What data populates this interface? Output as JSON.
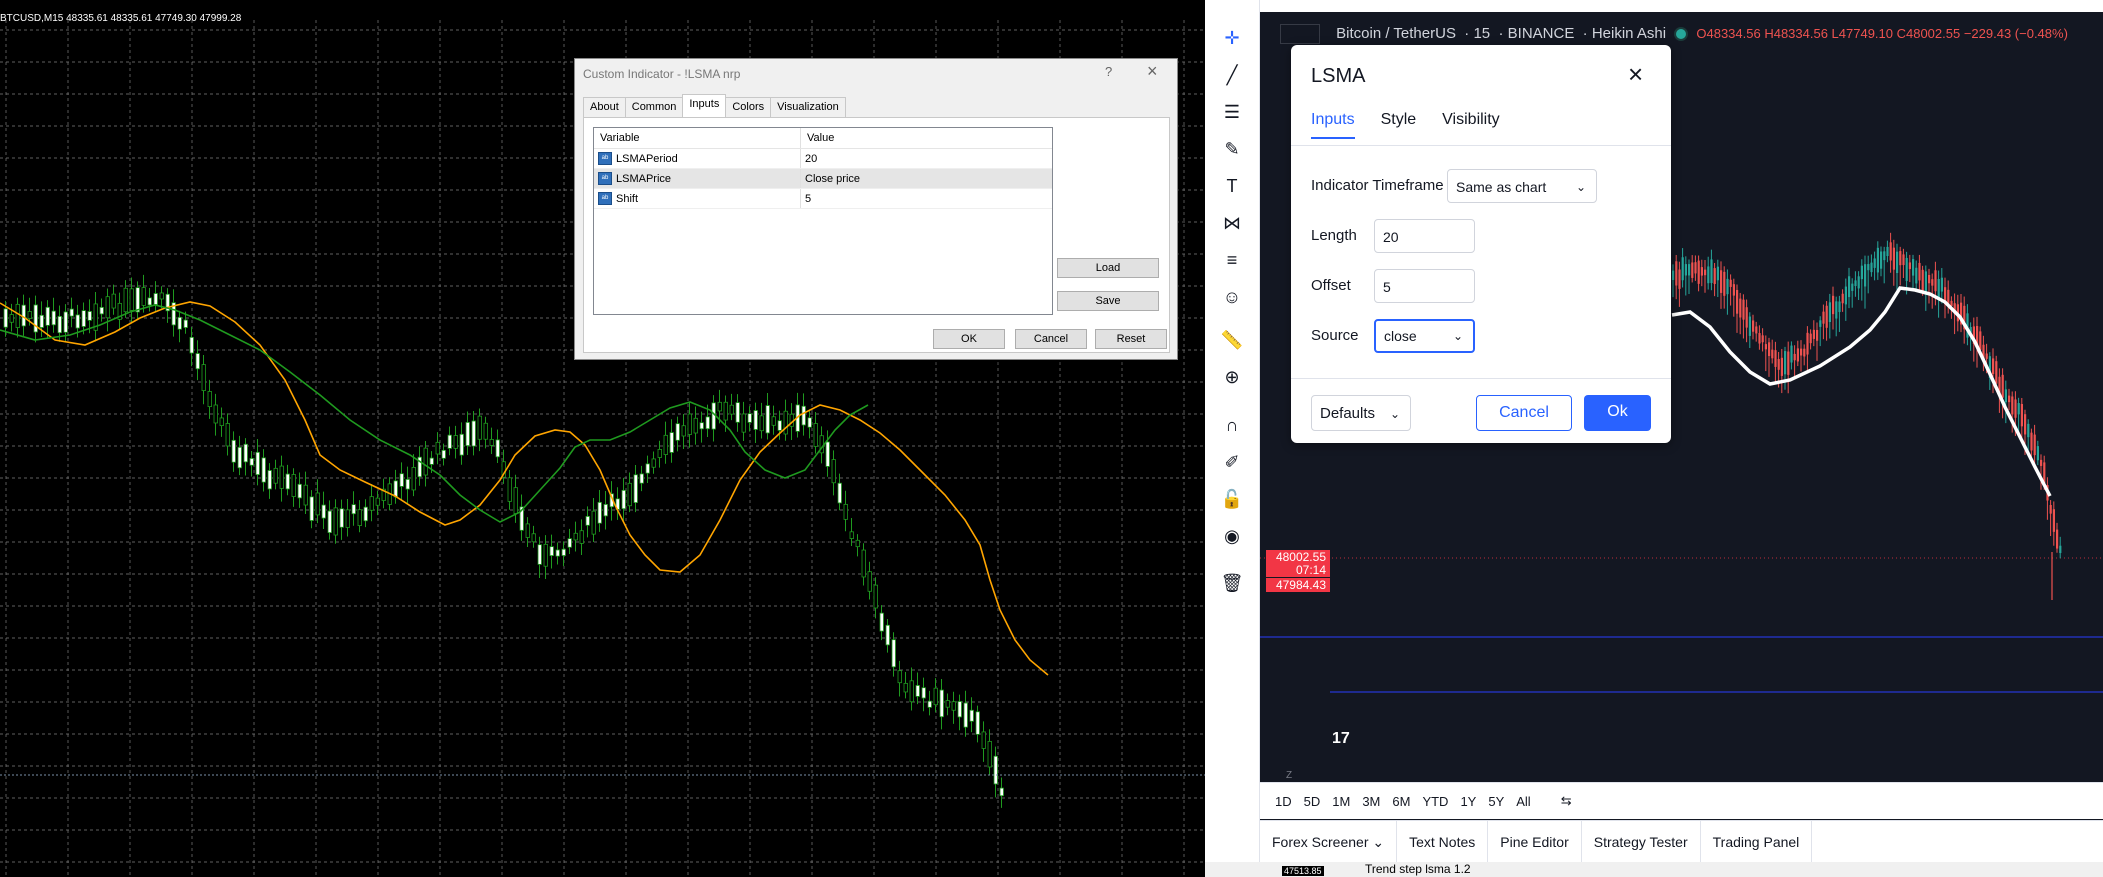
{
  "mt4": {
    "chart_info": "BTCUSD,M15  48335.61 48335.61 47749.30 47999.28",
    "bottom_price": "47513.85",
    "dialog": {
      "title": "Custom Indicator - !LSMA nrp",
      "help": "?",
      "close": "×",
      "tabs": [
        "About",
        "Common",
        "Inputs",
        "Colors",
        "Visualization"
      ],
      "active_tab": "Inputs",
      "table_headers": {
        "variable": "Variable",
        "value": "Value"
      },
      "params": [
        {
          "icon": "ab",
          "name": "LSMAPeriod",
          "value": "20"
        },
        {
          "icon": "ab",
          "name": "LSMAPrice",
          "value": "Close price"
        },
        {
          "icon": "ab",
          "name": "Shift",
          "value": "5"
        }
      ],
      "buttons": {
        "load": "Load",
        "save": "Save",
        "ok": "OK",
        "cancel": "Cancel",
        "reset": "Reset"
      }
    }
  },
  "tv": {
    "legend": {
      "symbol": "Bitcoin / TetherUS",
      "interval": "15",
      "exchange": "BINANCE",
      "chart_type": "Heikin Ashi",
      "ohlc": "O48334.56 H48334.56 L47749.10 C48002.55 −229.43 (−0.48%)"
    },
    "price_tags": {
      "price": "48002.55",
      "countdown": "07:14",
      "low": "47984.43"
    },
    "z_label": "Z",
    "tv_logo": "17",
    "ranges": [
      "1D",
      "5D",
      "1M",
      "3M",
      "6M",
      "YTD",
      "1Y",
      "5Y",
      "All"
    ],
    "bottom_tabs": [
      "Forex Screener ⌄",
      "Text Notes",
      "Pine Editor",
      "Strategy Tester",
      "Trading Panel"
    ],
    "below_item": "Trend step lsma 1.2",
    "dialog": {
      "title": "LSMA",
      "close": "×",
      "tabs": [
        "Inputs",
        "Style",
        "Visibility"
      ],
      "active_tab": "Inputs",
      "fields": {
        "timeframe_label": "Indicator Timeframe",
        "timeframe_value": "Same as chart",
        "length_label": "Length",
        "length_value": "20",
        "offset_label": "Offset",
        "offset_value": "5",
        "source_label": "Source",
        "source_value": "close"
      },
      "defaults": "Defaults",
      "cancel": "Cancel",
      "ok": "Ok"
    },
    "colors": {
      "accent": "#2962ff",
      "down": "#ef5350",
      "up": "#26a69a",
      "line": "#ffffff"
    }
  }
}
